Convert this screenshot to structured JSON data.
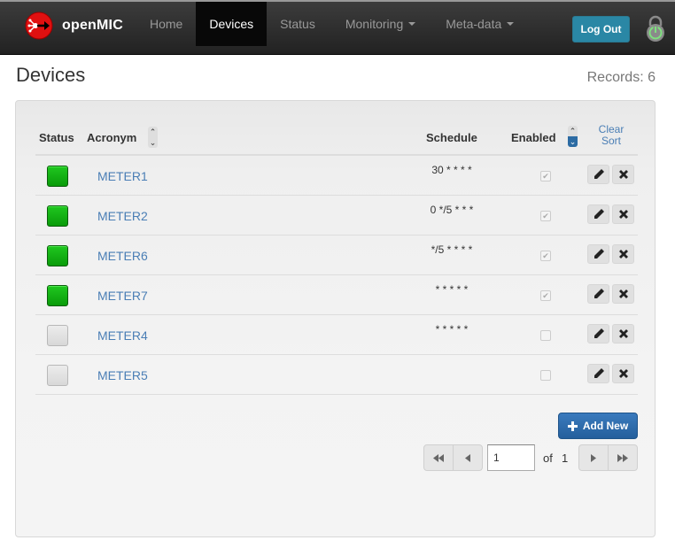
{
  "app": {
    "brand": "openMIC",
    "nav": [
      {
        "label": "Home",
        "active": false,
        "dropdown": false
      },
      {
        "label": "Devices",
        "active": true,
        "dropdown": false
      },
      {
        "label": "Status",
        "active": false,
        "dropdown": false
      },
      {
        "label": "Monitoring",
        "active": false,
        "dropdown": true
      },
      {
        "label": "Meta-data",
        "active": false,
        "dropdown": true
      }
    ],
    "logout_label": "Log Out"
  },
  "page": {
    "title": "Devices",
    "records_label": "Records: 6"
  },
  "table": {
    "columns": {
      "status": "Status",
      "acronym": "Acronym",
      "schedule": "Schedule",
      "enabled": "Enabled",
      "clear_sort": "Clear Sort"
    },
    "rows": [
      {
        "acronym": "METER1",
        "status": "online",
        "schedule": "30 * * * *",
        "enabled": true
      },
      {
        "acronym": "METER2",
        "status": "online",
        "schedule": "0 */5 * * *",
        "enabled": true
      },
      {
        "acronym": "METER6",
        "status": "online",
        "schedule": "*/5 * * * *",
        "enabled": true
      },
      {
        "acronym": "METER7",
        "status": "online",
        "schedule": "* * * * *",
        "enabled": true
      },
      {
        "acronym": "METER4",
        "status": "offline",
        "schedule": "* * * * *",
        "enabled": false
      },
      {
        "acronym": "METER5",
        "status": "offline",
        "schedule": "",
        "enabled": false
      }
    ]
  },
  "actions": {
    "add_new_label": "Add New"
  },
  "pagination": {
    "current_page": "1",
    "of_label": "of",
    "total_pages": "1"
  },
  "colors": {
    "accent": "#4a7eb5",
    "status_online": "#12b012",
    "status_offline": "#dcdcdc",
    "logout": "#2a87a5",
    "add_new": "#2c6ba3"
  },
  "icons": {
    "logo": "openmic-logo-icon",
    "power": "power-lock-icon",
    "edit": "pencil-icon",
    "delete": "close-icon",
    "add": "plus-icon",
    "first": "double-chevron-left-icon",
    "prev": "chevron-left-icon",
    "next": "chevron-right-icon",
    "last": "double-chevron-right-icon"
  }
}
